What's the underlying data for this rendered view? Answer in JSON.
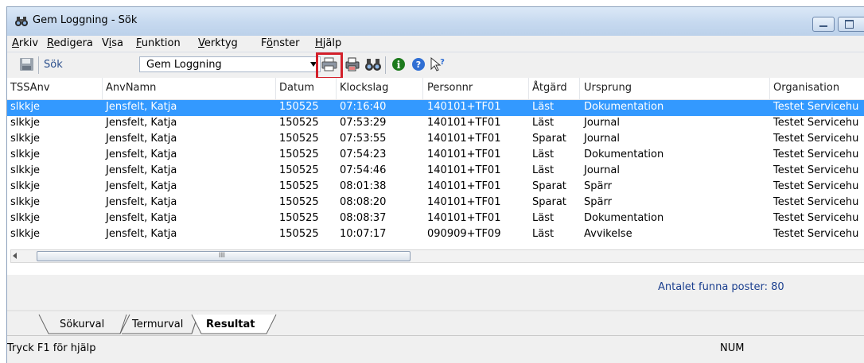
{
  "window": {
    "title": "Gem Loggning - Sök"
  },
  "menu": {
    "items": [
      {
        "id": "arkiv",
        "underline": "A",
        "rest": "rkiv"
      },
      {
        "id": "redigera",
        "underline": "R",
        "rest": "edigera"
      },
      {
        "id": "visa",
        "pre": "V",
        "underline": "i",
        "rest": "sa"
      },
      {
        "id": "funktion",
        "underline": "F",
        "rest": "unktion"
      },
      {
        "id": "verktyg",
        "underline": "V",
        "rest": "erktyg"
      },
      {
        "id": "fonster",
        "pre": "F",
        "underline": "ö",
        "rest": "nster"
      },
      {
        "id": "hjalp",
        "underline": "H",
        "rest": "jälp"
      }
    ]
  },
  "toolbar": {
    "search_label": "Sök",
    "combo_value": "Gem Loggning",
    "icons": [
      "save-icon",
      "print-icon",
      "print-preview-icon",
      "binoculars-icon",
      "info-icon",
      "help-icon",
      "whats-this-icon"
    ]
  },
  "table": {
    "columns": [
      "TSSAnv",
      "AnvNamn",
      "Datum",
      "Klockslag",
      "Personnr",
      "Åtgärd",
      "Ursprung",
      "Organisation"
    ],
    "rows": [
      [
        "slkkje",
        "Jensfelt, Katja",
        "150525",
        "07:16:40",
        "140101+TF01",
        "Läst",
        "Dokumentation",
        "Testet Servicehu"
      ],
      [
        "slkkje",
        "Jensfelt, Katja",
        "150525",
        "07:53:29",
        "140101+TF01",
        "Läst",
        "Journal",
        "Testet Servicehu"
      ],
      [
        "slkkje",
        "Jensfelt, Katja",
        "150525",
        "07:53:55",
        "140101+TF01",
        "Sparat",
        "Journal",
        "Testet Servicehu"
      ],
      [
        "slkkje",
        "Jensfelt, Katja",
        "150525",
        "07:54:23",
        "140101+TF01",
        "Läst",
        "Dokumentation",
        "Testet Servicehu"
      ],
      [
        "slkkje",
        "Jensfelt, Katja",
        "150525",
        "07:54:46",
        "140101+TF01",
        "Läst",
        "Journal",
        "Testet Servicehu"
      ],
      [
        "slkkje",
        "Jensfelt, Katja",
        "150525",
        "08:01:38",
        "140101+TF01",
        "Sparat",
        "Spärr",
        "Testet Servicehu"
      ],
      [
        "slkkje",
        "Jensfelt, Katja",
        "150525",
        "08:08:20",
        "140101+TF01",
        "Sparat",
        "Spärr",
        "Testet Servicehu"
      ],
      [
        "slkkje",
        "Jensfelt, Katja",
        "150525",
        "08:08:37",
        "140101+TF01",
        "Läst",
        "Dokumentation",
        "Testet Servicehu"
      ],
      [
        "slkkje",
        "Jensfelt, Katja",
        "150525",
        "10:07:17",
        "090909+TF09",
        "Läst",
        "Avvikelse",
        "Testet Servicehu"
      ]
    ],
    "selected_row": 0,
    "scroll_grip": "III"
  },
  "result_count": "Antalet funna poster: 80",
  "tabs": [
    {
      "label": "Sökurval",
      "active": false
    },
    {
      "label": "Termurval",
      "active": false
    },
    {
      "label": "Resultat",
      "active": true
    }
  ],
  "statusbar": {
    "help": "Tryck F1 för hjälp",
    "num": "NUM"
  },
  "colors": {
    "selection": "#3399ff",
    "highlight_box": "#d3202a",
    "count_text": "#1b3f8f"
  }
}
